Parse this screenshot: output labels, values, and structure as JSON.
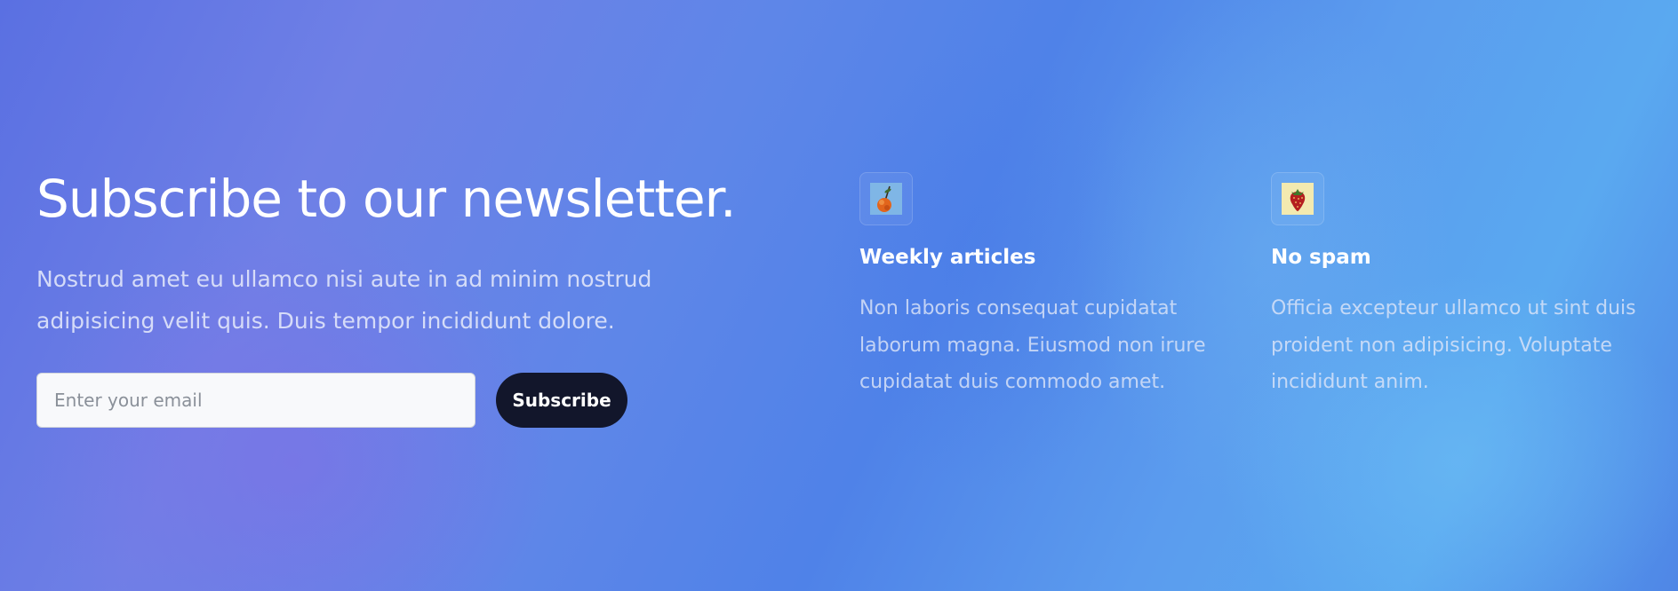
{
  "newsletter": {
    "headline": "Subscribe to our newsletter.",
    "description": "Nostrud amet eu ullamco nisi aute in ad minim nostrud adipisicing velit quis. Duis tempor incididunt dolore.",
    "email_placeholder": "Enter your email",
    "email_value": "",
    "subscribe_label": "Subscribe"
  },
  "features": [
    {
      "icon": "peach-fruit-icon",
      "title": "Weekly articles",
      "text": "Non laboris consequat cupidatat laborum magna. Eiusmod non irure cupidatat duis commodo amet."
    },
    {
      "icon": "strawberry-icon",
      "title": "No spam",
      "text": "Officia excepteur ullamco ut sint duis proident non adipisicing. Voluptate incididunt anim."
    }
  ],
  "colors": {
    "button_background": "#12162b",
    "button_text": "#ffffff",
    "input_background": "#f8f9fb",
    "heading": "#ffffff"
  }
}
